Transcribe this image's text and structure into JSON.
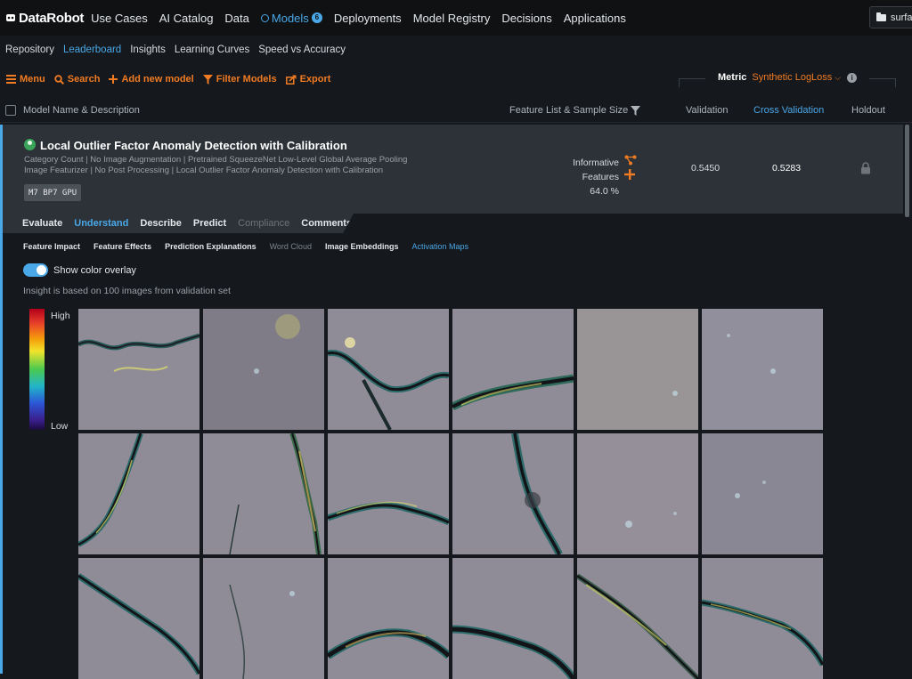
{
  "topnav": {
    "logo": "DataRobot",
    "items": [
      "Use Cases",
      "AI Catalog",
      "Data",
      "Models",
      "Deployments",
      "Model Registry",
      "Decisions",
      "Applications"
    ],
    "models_badge": "6",
    "project": "surface"
  },
  "subnav": {
    "items": [
      "Repository",
      "Leaderboard",
      "Insights",
      "Learning Curves",
      "Speed vs Accuracy"
    ]
  },
  "toolbar": {
    "menu": "Menu",
    "search": "Search",
    "add": "Add new model",
    "filter": "Filter Models",
    "export": "Export",
    "metric_label": "Metric",
    "metric_value": "Synthetic LogLoss"
  },
  "columns": {
    "name": "Model Name & Description",
    "feature": "Feature List & Sample Size",
    "validation": "Validation",
    "cv": "Cross Validation",
    "holdout": "Holdout"
  },
  "model": {
    "title": "Local Outlier Factor Anomaly Detection with Calibration",
    "description": "Category Count | No Image Augmentation | Pretrained SqueezeNet Low-Level Global Average Pooling Image Featurizer | No Post Processing | Local Outlier Factor Anomaly Detection with Calibration",
    "tags": "M7  BP7  GPU",
    "feature_list": "Informative Features",
    "sample_size": "64.0 %",
    "validation": "0.5450",
    "cross_validation": "0.5283"
  },
  "tabs": [
    {
      "label": "Evaluate"
    },
    {
      "label": "Understand"
    },
    {
      "label": "Describe"
    },
    {
      "label": "Predict"
    },
    {
      "label": "Compliance"
    },
    {
      "label": "Comments"
    }
  ],
  "subtabs": [
    "Feature Impact",
    "Feature Effects",
    "Prediction Explanations",
    "Word Cloud",
    "Image Embeddings",
    "Activation Maps"
  ],
  "overlay": {
    "toggle_label": "Show color overlay",
    "enabled": true,
    "insight": "Insight is based on 100 images from validation set"
  },
  "legend": {
    "high": "High",
    "low": "Low"
  },
  "colors": {
    "accent": "#4aa8e8",
    "orange": "#f07b23",
    "background": "#15181c"
  }
}
